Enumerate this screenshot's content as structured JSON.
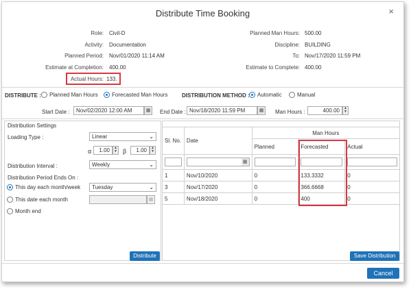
{
  "dialog": {
    "title": "Distribute Time Booking",
    "close_glyph": "×"
  },
  "info": {
    "role_label": "Role:",
    "role_value": "Civil-D",
    "activity_label": "Activity:",
    "activity_value": "Documentation",
    "planned_period_label": "Planned Period:",
    "planned_period_value": "Nov/01/2020 11:14 AM",
    "estimate_completion_label": "Estimate at Completion:",
    "estimate_completion_value": "400.00",
    "actual_hours_label": "Actual Hours:",
    "actual_hours_value": "133.",
    "planned_man_hours_label": "Planned Man Hours:",
    "planned_man_hours_value": "500.00",
    "discipline_label": "Discipline:",
    "discipline_value": "BUILDING",
    "to_label": "To:",
    "to_value": "Nov/17/2020 11:59 PM",
    "estimate_complete_label": "Estimate to Complete:",
    "estimate_complete_value": "400.00"
  },
  "distribute": {
    "label": "DISTRIBUTE :",
    "option_planned": "Planned Man Hours",
    "option_forecasted": "Forecasted Man Hours",
    "method_label": "DISTRIBUTION METHOD :",
    "option_automatic": "Automatic",
    "option_manual": "Manual",
    "start_date_label": "Start Date :",
    "start_date_value": "Nov/02/2020 12:00 AM",
    "end_date_label": "End Date :",
    "end_date_value": "Nov/18/2020 11:59 PM",
    "man_hours_label": "Man Hours :",
    "man_hours_value": "400.00"
  },
  "settings": {
    "title": "Distribution Settings",
    "loading_type_label": "Loading Type :",
    "loading_type_value": "Linear",
    "alpha_label": "α",
    "alpha_value": "1.00",
    "beta_label": "β",
    "beta_value": "1.00",
    "interval_label": "Distribution Interval :",
    "interval_value": "Weekly",
    "period_ends_label": "Distribution Period Ends On :",
    "option_day_week": "This day each month/week",
    "day_value": "Tuesday",
    "option_date_month": "This date each month",
    "option_month_end": "Month end",
    "distribute_button": "Distribute"
  },
  "grid": {
    "col_slno": "Sl. No.",
    "col_date": "Date",
    "group_man_hours": "Man Hours",
    "col_planned": "Planned",
    "col_forecasted": "Forecasted",
    "col_actual": "Actual",
    "rows": [
      {
        "slno": "1",
        "date": "Nov/10/2020",
        "planned": "0",
        "forecasted": "133.3332",
        "actual": "0"
      },
      {
        "slno": "3",
        "date": "Nov/17/2020",
        "planned": "0",
        "forecasted": "366.6668",
        "actual": "0"
      },
      {
        "slno": "5",
        "date": "Nov/18/2020",
        "planned": "0",
        "forecasted": "400",
        "actual": "0"
      }
    ],
    "save_button": "Save Distribution"
  },
  "footer": {
    "cancel_button": "Cancel"
  },
  "icons": {
    "calendar": "calendar-icon",
    "spin": "spinner-arrows-icon",
    "dropdown": "chevron-down-icon"
  },
  "colors": {
    "accent": "#1f72b8",
    "highlight": "#d9363e",
    "radio_selected": "#1e73be"
  }
}
